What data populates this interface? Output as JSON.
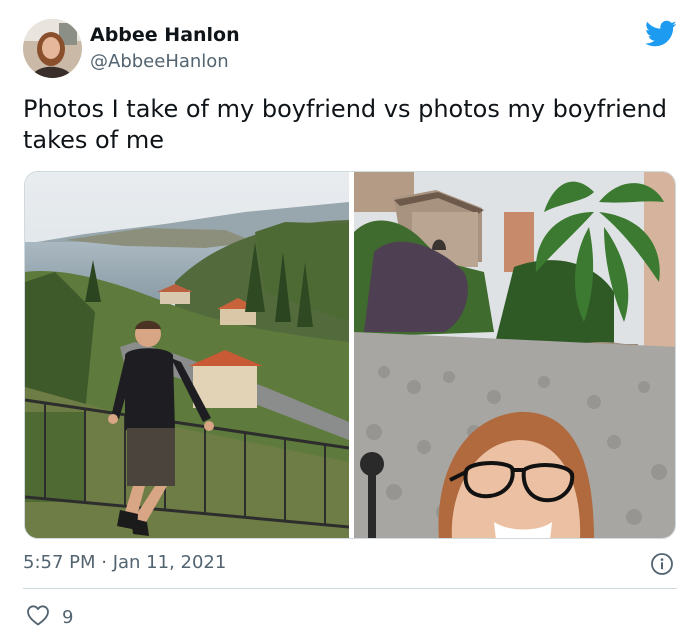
{
  "author": {
    "display_name": "Abbee Hanlon",
    "handle": "@AbbeeHanlon"
  },
  "tweet": {
    "text": "Photos I take of my boyfriend vs photos my boyfriend takes of me",
    "timestamp": "5:57 PM · Jan 11, 2021",
    "like_count": "9"
  },
  "icons": {
    "brand": "twitter-bird-icon",
    "info": "info-icon",
    "like": "heart-icon"
  },
  "colors": {
    "twitter_blue": "#1d9bf0",
    "text_primary": "#0f1419",
    "text_secondary": "#536471",
    "divider": "#cfd9de"
  }
}
